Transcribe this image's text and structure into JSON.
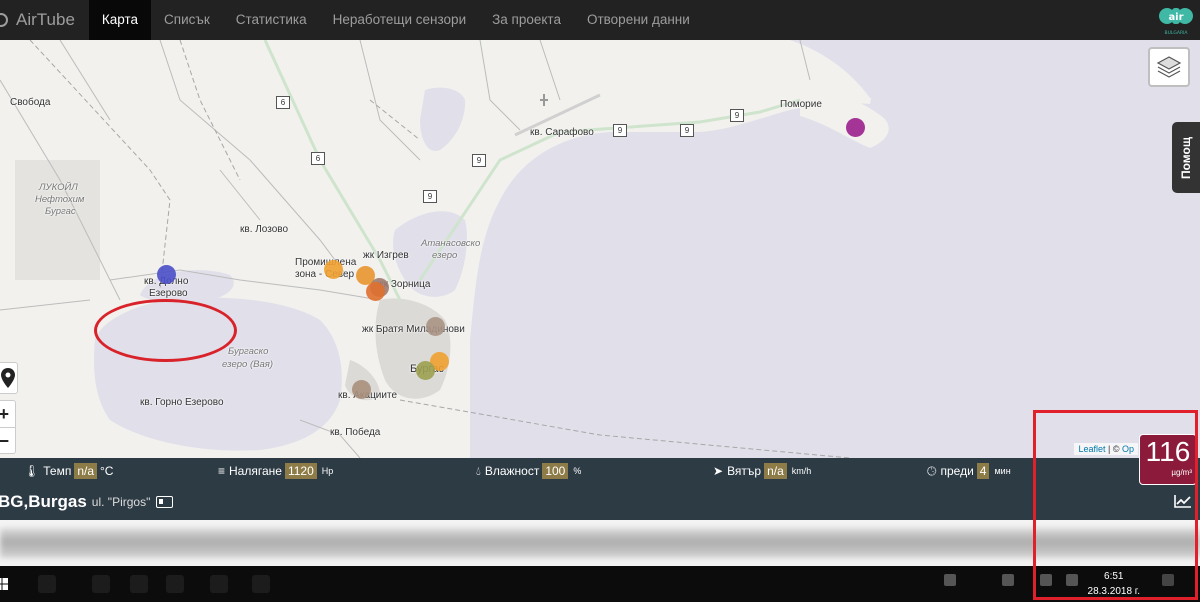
{
  "app": {
    "brand": "AirTube"
  },
  "nav": {
    "items": [
      {
        "label": "Карта",
        "active": true
      },
      {
        "label": "Списък",
        "active": false
      },
      {
        "label": "Статистика",
        "active": false
      },
      {
        "label": "Неработещи сензори",
        "active": false
      },
      {
        "label": "За проекта",
        "active": false
      },
      {
        "label": "Отворени данни",
        "active": false
      }
    ],
    "partner_logo": {
      "text": "air",
      "subtext": "BULGARIA"
    }
  },
  "map": {
    "places": {
      "svoboda": "Свобода",
      "lukoil_1": "ЛУКОЙЛ",
      "lukoil_2": "Нефтохим",
      "lukoil_3": "Бургас",
      "lozovo": "кв. Лозово",
      "dolno_ezerovo_1": "кв. Долно",
      "dolno_ezerovo_2": "Езерово",
      "gorno_ezerovo": "кв. Горно Езерово",
      "burgas_lake_1": "Бургаско",
      "burgas_lake_2": "езеро (Вая)",
      "industrial_1": "Промишлена",
      "industrial_2": "зона - Север",
      "izgrev": "жк Изгрев",
      "zornitsa": "жк Зорница",
      "bratya_miladinovi": "жк Братя Миладинови",
      "burgas": "Бургас",
      "akatsiite": "кв. Акациите",
      "pobeda": "кв. Победа",
      "sarafovo": "кв. Сарафово",
      "pomorie": "Поморие",
      "atanasovsko_1": "Атанасовско",
      "atanasovsko_2": "езеро"
    },
    "road_numbers": [
      "6",
      "6",
      "9",
      "9",
      "9",
      "9",
      "9"
    ],
    "markers": [
      {
        "color": "#4a4fc8"
      },
      {
        "color": "#f0a030"
      },
      {
        "color": "#e8962e"
      },
      {
        "color": "#9e7a6e"
      },
      {
        "color": "#e0702e"
      },
      {
        "color": "#a89484"
      },
      {
        "color": "#f0a030"
      },
      {
        "color": "#9ca050"
      },
      {
        "color": "#a88f7c"
      },
      {
        "color": "#9b1f8c"
      }
    ],
    "help_label": "Помощ",
    "zoom_in": "+",
    "zoom_out": "−",
    "attribution": {
      "leaflet": "Leaflet",
      "separator": "| ©",
      "osm": "Op"
    }
  },
  "sensor": {
    "temperature": {
      "label": "Темп",
      "value": "n/a",
      "unit": "°C"
    },
    "pressure": {
      "label": "Налягане",
      "value": "1120",
      "unit": "Hp"
    },
    "humidity": {
      "label": "Влажност",
      "value": "100",
      "unit": "%"
    },
    "wind": {
      "label": "Вятър",
      "value": "n/a",
      "unit": "km/h"
    },
    "ago": {
      "label": "преди",
      "value": "4",
      "unit": "мин"
    },
    "city": "BG,Burgas",
    "street": "ul. \"Pirgos\"",
    "aqi": {
      "value": "116",
      "unit": "µg/m³",
      "color": "#8c1a3a"
    }
  },
  "taskbar": {
    "time": "6:51",
    "date": "28.3.2018 г."
  },
  "colors": {
    "water": "#e1dfea",
    "land": "#f2f1ee",
    "accent_red": "#e0202a"
  }
}
